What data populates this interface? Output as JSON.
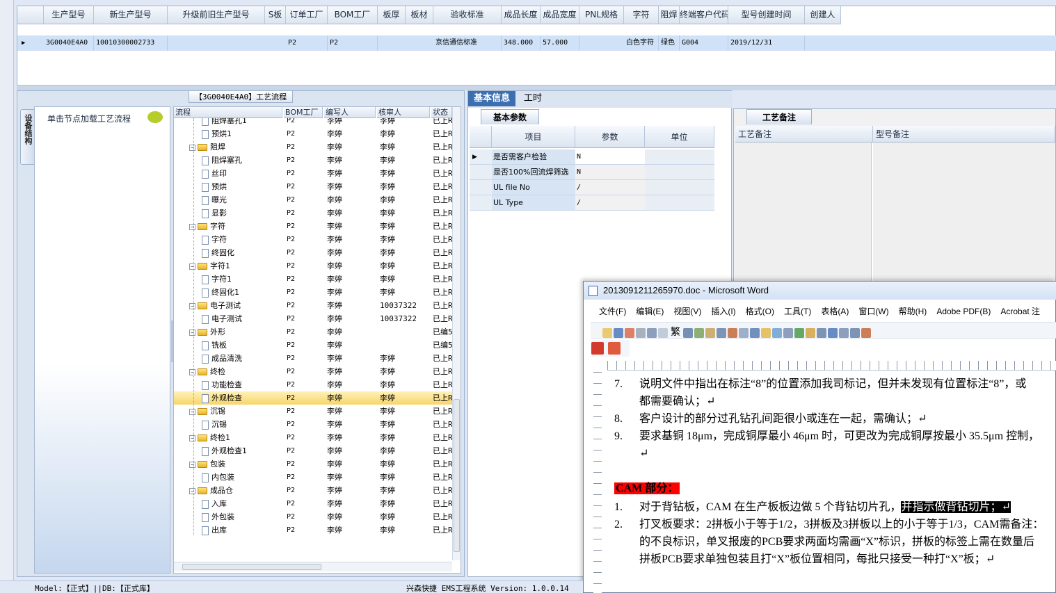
{
  "top_grid": {
    "headers": [
      "生产型号",
      "新生产型号",
      "升级前旧生产型号",
      "S板",
      "订单工厂",
      "BOM工厂",
      "板厚",
      "板材",
      "验收标准",
      "成品长度",
      "成品宽度",
      "PNL规格",
      "字符",
      "阻焊",
      "终端客户代码",
      "型号创建时间",
      "创建人"
    ],
    "row": [
      "3G0040E4A0",
      "10010300002733",
      "",
      "",
      "P2",
      "P2",
      "",
      "",
      "京信通信标准",
      "348.000",
      "57.000",
      "",
      "白色字符",
      "绿色",
      "G004",
      "2019/12/31",
      ""
    ]
  },
  "flow_panel": {
    "title": "【3G0040E4A0】工艺流程",
    "side_tab": "设备结构",
    "load_hint": "单击节点加载工艺流程",
    "headers": [
      "流程",
      "BOM工厂",
      "编写人",
      "核审人",
      "状态"
    ],
    "rows": [
      {
        "name": "阻焊塞孔1",
        "level": 2,
        "bom": "P2",
        "writer": "李婷",
        "reviewer": "李婷",
        "status": "已上R"
      },
      {
        "name": "预烘1",
        "level": 2,
        "bom": "P2",
        "writer": "李婷",
        "reviewer": "李婷",
        "status": "已上R"
      },
      {
        "name": "阻焊",
        "level": 1,
        "bom": "P2",
        "writer": "李婷",
        "reviewer": "李婷",
        "status": "已上R"
      },
      {
        "name": "阻焊塞孔",
        "level": 2,
        "bom": "P2",
        "writer": "李婷",
        "reviewer": "李婷",
        "status": "已上R"
      },
      {
        "name": "丝印",
        "level": 2,
        "bom": "P2",
        "writer": "李婷",
        "reviewer": "李婷",
        "status": "已上R"
      },
      {
        "name": "预烘",
        "level": 2,
        "bom": "P2",
        "writer": "李婷",
        "reviewer": "李婷",
        "status": "已上R"
      },
      {
        "name": "曝光",
        "level": 2,
        "bom": "P2",
        "writer": "李婷",
        "reviewer": "李婷",
        "status": "已上R"
      },
      {
        "name": "显影",
        "level": 2,
        "bom": "P2",
        "writer": "李婷",
        "reviewer": "李婷",
        "status": "已上R"
      },
      {
        "name": "字符",
        "level": 1,
        "bom": "P2",
        "writer": "李婷",
        "reviewer": "李婷",
        "status": "已上R"
      },
      {
        "name": "字符",
        "level": 2,
        "bom": "P2",
        "writer": "李婷",
        "reviewer": "李婷",
        "status": "已上R"
      },
      {
        "name": "终固化",
        "level": 2,
        "bom": "P2",
        "writer": "李婷",
        "reviewer": "李婷",
        "status": "已上R"
      },
      {
        "name": "字符1",
        "level": 1,
        "bom": "P2",
        "writer": "李婷",
        "reviewer": "李婷",
        "status": "已上R"
      },
      {
        "name": "字符1",
        "level": 2,
        "bom": "P2",
        "writer": "李婷",
        "reviewer": "李婷",
        "status": "已上R"
      },
      {
        "name": "终固化1",
        "level": 2,
        "bom": "P2",
        "writer": "李婷",
        "reviewer": "李婷",
        "status": "已上R"
      },
      {
        "name": "电子测试",
        "level": 1,
        "bom": "P2",
        "writer": "李婷",
        "reviewer": "10037322",
        "status": "已上R"
      },
      {
        "name": "电子测试",
        "level": 2,
        "bom": "P2",
        "writer": "李婷",
        "reviewer": "10037322",
        "status": "已上R"
      },
      {
        "name": "外形",
        "level": 1,
        "bom": "P2",
        "writer": "李婷",
        "reviewer": "",
        "status": "已编5"
      },
      {
        "name": "铣板",
        "level": 2,
        "bom": "P2",
        "writer": "李婷",
        "reviewer": "",
        "status": "已编5"
      },
      {
        "name": "成品清洗",
        "level": 2,
        "bom": "P2",
        "writer": "李婷",
        "reviewer": "李婷",
        "status": "已上R"
      },
      {
        "name": "终检",
        "level": 1,
        "bom": "P2",
        "writer": "李婷",
        "reviewer": "李婷",
        "status": "已上R"
      },
      {
        "name": "功能检查",
        "level": 2,
        "bom": "P2",
        "writer": "李婷",
        "reviewer": "李婷",
        "status": "已上R"
      },
      {
        "name": "外观检查",
        "level": 2,
        "bom": "P2",
        "writer": "李婷",
        "reviewer": "李婷",
        "status": "已上R",
        "selected": true
      },
      {
        "name": "沉锡",
        "level": 1,
        "bom": "P2",
        "writer": "李婷",
        "reviewer": "李婷",
        "status": "已上R"
      },
      {
        "name": "沉锡",
        "level": 2,
        "bom": "P2",
        "writer": "李婷",
        "reviewer": "李婷",
        "status": "已上R"
      },
      {
        "name": "终检1",
        "level": 1,
        "bom": "P2",
        "writer": "李婷",
        "reviewer": "李婷",
        "status": "已上R"
      },
      {
        "name": "外观检查1",
        "level": 2,
        "bom": "P2",
        "writer": "李婷",
        "reviewer": "李婷",
        "status": "已上R"
      },
      {
        "name": "包装",
        "level": 1,
        "bom": "P2",
        "writer": "李婷",
        "reviewer": "李婷",
        "status": "已上R"
      },
      {
        "name": "内包装",
        "level": 2,
        "bom": "P2",
        "writer": "李婷",
        "reviewer": "李婷",
        "status": "已上R"
      },
      {
        "name": "成品仓",
        "level": 1,
        "bom": "P2",
        "writer": "李婷",
        "reviewer": "李婷",
        "status": "已上R"
      },
      {
        "name": "入库",
        "level": 2,
        "bom": "P2",
        "writer": "李婷",
        "reviewer": "李婷",
        "status": "已上R"
      },
      {
        "name": "外包装",
        "level": 2,
        "bom": "P2",
        "writer": "李婷",
        "reviewer": "李婷",
        "status": "已上R"
      },
      {
        "name": "出库",
        "level": 2,
        "bom": "P2",
        "writer": "李婷",
        "reviewer": "李婷",
        "status": "已上R"
      }
    ]
  },
  "basic_panel": {
    "tabs": [
      "基本信息",
      "工时"
    ],
    "sub_tab": "基本参数",
    "headers": [
      "项目",
      "参数",
      "单位"
    ],
    "rows": [
      {
        "item": "是否需客户检验",
        "param": "N",
        "unit": ""
      },
      {
        "item": "是否100%回流焊筛选",
        "param": "N",
        "unit": ""
      },
      {
        "item": "UL file No",
        "param": "/",
        "unit": ""
      },
      {
        "item": "UL Type",
        "param": "/",
        "unit": ""
      }
    ]
  },
  "remark_panel": {
    "tab": "工艺备注",
    "headers": [
      "工艺备注",
      "型号备注"
    ]
  },
  "word": {
    "title": "2013091211265970.doc - Microsoft Word",
    "menu": [
      "文件(F)",
      "编辑(E)",
      "视图(V)",
      "插入(I)",
      "格式(O)",
      "工具(T)",
      "表格(A)",
      "窗口(W)",
      "帮助(H)",
      "Adobe PDF(B)",
      "Acrobat 注"
    ],
    "toolbar_glyph": "繁",
    "lines": [
      {
        "n": "7.",
        "text": "说明文件中指出在标注“8”的位置添加我司标记，但并未发现有位置标注“8”，或"
      },
      {
        "n": "",
        "text": "都需要确认；↵"
      },
      {
        "n": "8.",
        "text": "客户设计的部分过孔钻孔间距很小或连在一起，需确认；↵"
      },
      {
        "n": "9.",
        "text": "要求基铜 18μm，完成铜厚最小 46μm 时，可更改为完成铜厚按最小 35.5μm 控制，"
      },
      {
        "n": "",
        "text": "↵"
      },
      {
        "n": "",
        "text": ""
      },
      {
        "n": "",
        "text": "CAM 部分：",
        "style": "red"
      },
      {
        "n": "1.",
        "text": "对于背钻板，CAM 在生产板板边做 5 个背钻切片孔，",
        "hl": "并指示做背钻切片；↵"
      },
      {
        "n": "2.",
        "text": "打叉板要求：2拼板小于等于1/2，3拼板及3拼板以上的小于等于1/3，CAM需备注："
      },
      {
        "n": "",
        "text": "的不良标识，单叉报废的PCB要求两面均需画“X”标识，拼板的标签上需在数量后"
      },
      {
        "n": "",
        "text": "拼板PCB要求单独包装且打“X”板位置相同，每批只接受一种打“X”板；↵"
      }
    ]
  },
  "status": {
    "left": "Model:【正式】||DB:【正式库】",
    "right": "兴森快捷 EMS工程系统 Version: 1.0.0.14"
  }
}
